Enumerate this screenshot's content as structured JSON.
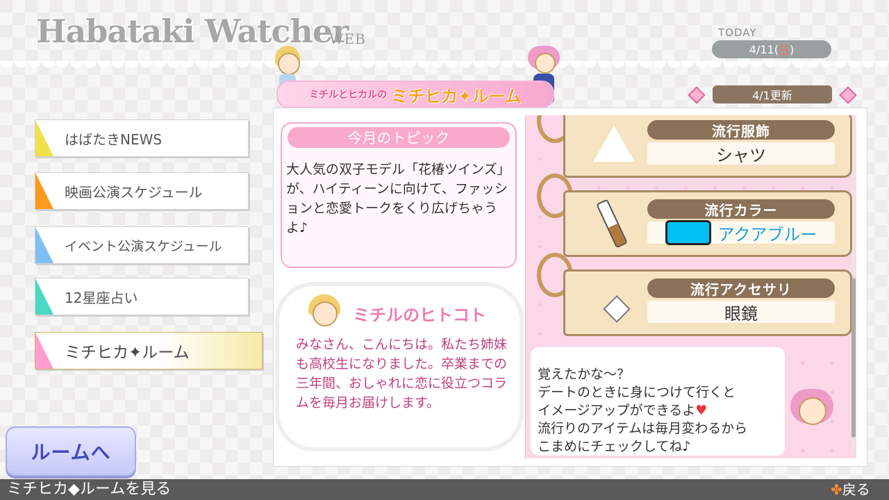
{
  "header": {
    "logo": "Habataki Watcher",
    "logo_suffix": "WEB",
    "today_label": "TODAY",
    "date_prefix": "4/11(",
    "date_day": "日",
    "date_suffix": ")"
  },
  "menu": {
    "items": [
      {
        "label": "はばたきNEWS",
        "color": "#f0e04a"
      },
      {
        "label": "映画公演スケジュール",
        "color": "#ff9a1e"
      },
      {
        "label": "イベント公演スケジュール",
        "color": "#7fc0f4"
      },
      {
        "label": "12星座占い",
        "color": "#4cd9c4"
      },
      {
        "label": "ミチヒカ✦ルーム",
        "color": "#ff9fd0"
      }
    ],
    "room_button": "ルームへ"
  },
  "banner": {
    "small": "ミチルとヒカルの",
    "big": "ミチヒカ✦ルーム"
  },
  "update": "4/1更新",
  "topic": {
    "title": "今月のトピック",
    "body": "大人気の双子モデル「花椿ツインズ」が、ハイティーンに向けて、ファッションと恋愛トークをくり広げちゃうよ♪"
  },
  "comment": {
    "title": "ミチルのヒトコト",
    "body": "みなさん、こんにちは。私たち姉妹も高校生になりました。卒業までの三年間、おしゃれに恋に役立つコラムを毎月お届けします。"
  },
  "trends": [
    {
      "label": "流行服飾",
      "value": "シャツ",
      "icon": "skirt-icon"
    },
    {
      "label": "流行カラー",
      "value": "アクアブルー",
      "icon": "brush-icon",
      "swatch": "#00c2f2"
    },
    {
      "label": "流行アクセサリ",
      "value": "眼鏡",
      "icon": "earring-icon"
    }
  ],
  "speech": {
    "line1": "覚えたかな～？",
    "line2": "デートのときに身につけて行くと",
    "line3": "イメージアップができるよ",
    "line4": "流行りのアイテムは毎月変わるから",
    "line5": "こまめにチェックしてね♪"
  },
  "footer": {
    "hint": "ミチヒカ◆ルームを見る",
    "back": "戻る"
  }
}
